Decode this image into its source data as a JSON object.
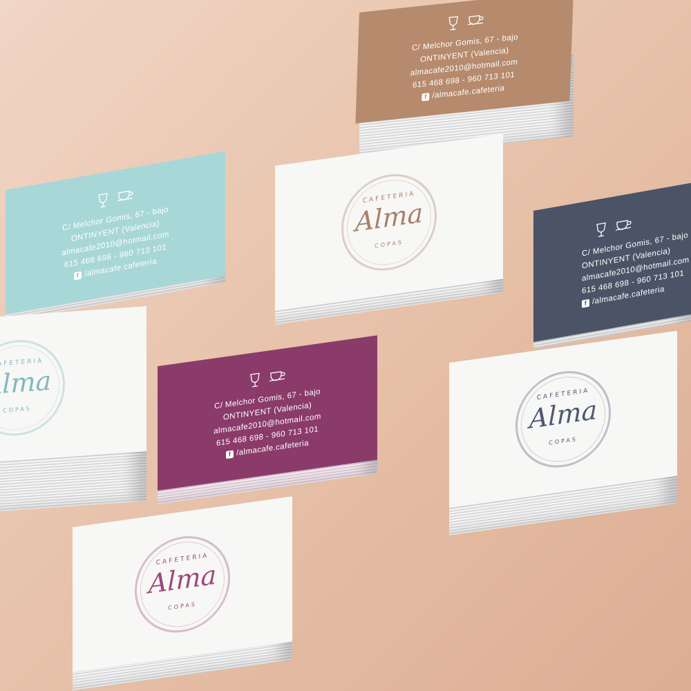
{
  "contact": {
    "address": "C/ Melchor Gomis, 67 - bajo",
    "city": "ONTINYENT (Valencia)",
    "email": "almacafe2010@hotmail.com",
    "phones": "615 468 698 - 960 713 101",
    "facebook": "/almacafe.cafeteria",
    "facebook_glyph": "f"
  },
  "logo": {
    "top": "CAFETERIA",
    "main": "Alma",
    "bottom": "COPAS"
  },
  "colors": {
    "background": "#e8c3ab",
    "brown": "#b68a6c",
    "teal": "#a8d7d7",
    "navy": "#4a5466",
    "plum": "#8a3b6a",
    "white_card": "#f7f7f6",
    "logo_brown": "#a7806a",
    "logo_teal": "#7fb9bd",
    "logo_navy": "#4e5870",
    "logo_plum": "#9a4a7c"
  },
  "icons": [
    "wine-glass-icon",
    "coffee-cup-icon",
    "facebook-icon"
  ]
}
